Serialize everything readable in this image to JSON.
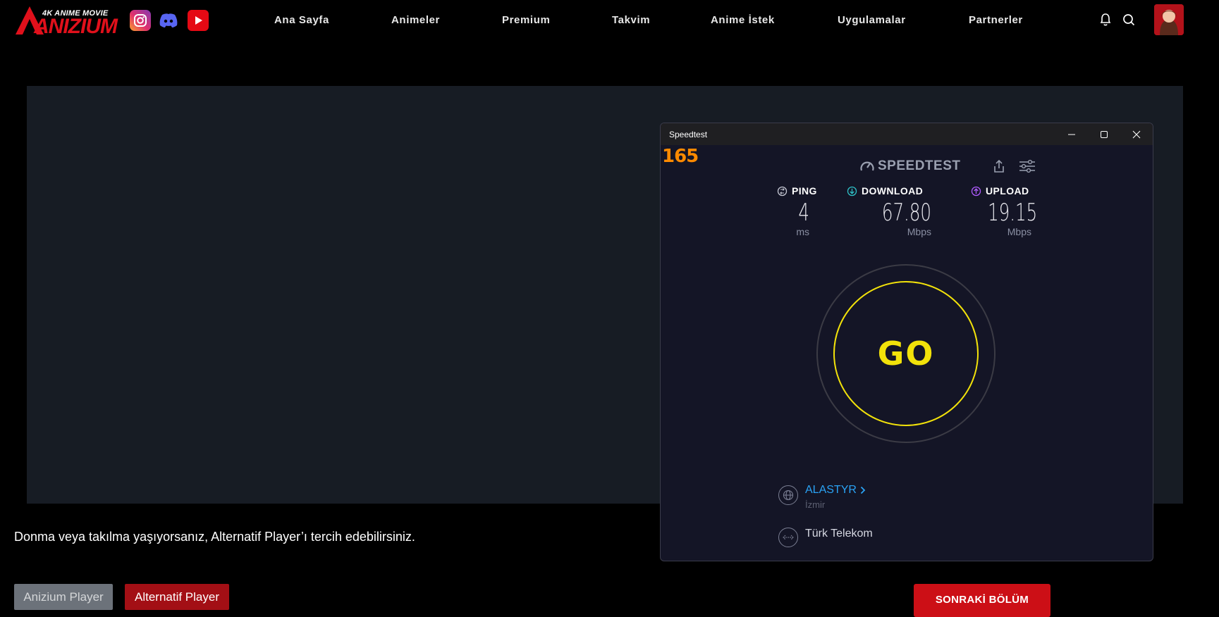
{
  "header": {
    "logo_tag": "4K ANIME MOVIE",
    "logo_word": "ANIZIUM",
    "social": [
      "instagram-icon",
      "discord-icon",
      "youtube-icon"
    ],
    "nav": [
      "Ana Sayfa",
      "Animeler",
      "Premium",
      "Takvim",
      "Anime İstek",
      "Uygulamalar",
      "Partnerler"
    ],
    "icons": [
      "bell-icon",
      "search-icon"
    ]
  },
  "notice": "Donma veya takılma yaşıyorsanız, Alternatif Player’ı tercih edebilirsiniz.",
  "buttons": {
    "player1": "Anizium Player",
    "player2": "Alternatif Player",
    "next_episode": "SONRAKİ BÖLÜM"
  },
  "speedtest": {
    "window_title": "Speedtest",
    "fps_counter": "165",
    "brand": "SPEEDTEST",
    "ping": {
      "label": "PING",
      "value": "4",
      "unit": "ms"
    },
    "download": {
      "label": "DOWNLOAD",
      "value": "67.80",
      "unit": "Mbps"
    },
    "upload": {
      "label": "UPLOAD",
      "value": "19.15",
      "unit": "Mbps"
    },
    "go_label": "GO",
    "server": {
      "host": "ALASTYR",
      "city": "İzmir"
    },
    "isp": "Türk Telekom"
  },
  "colors": {
    "brand_red": "#e0101b",
    "go_yellow": "#f2e20a",
    "fps_orange": "#ff8a00",
    "host_blue": "#2aa3f5",
    "download_teal": "#2fc3c9",
    "upload_purple": "#b05cff"
  }
}
